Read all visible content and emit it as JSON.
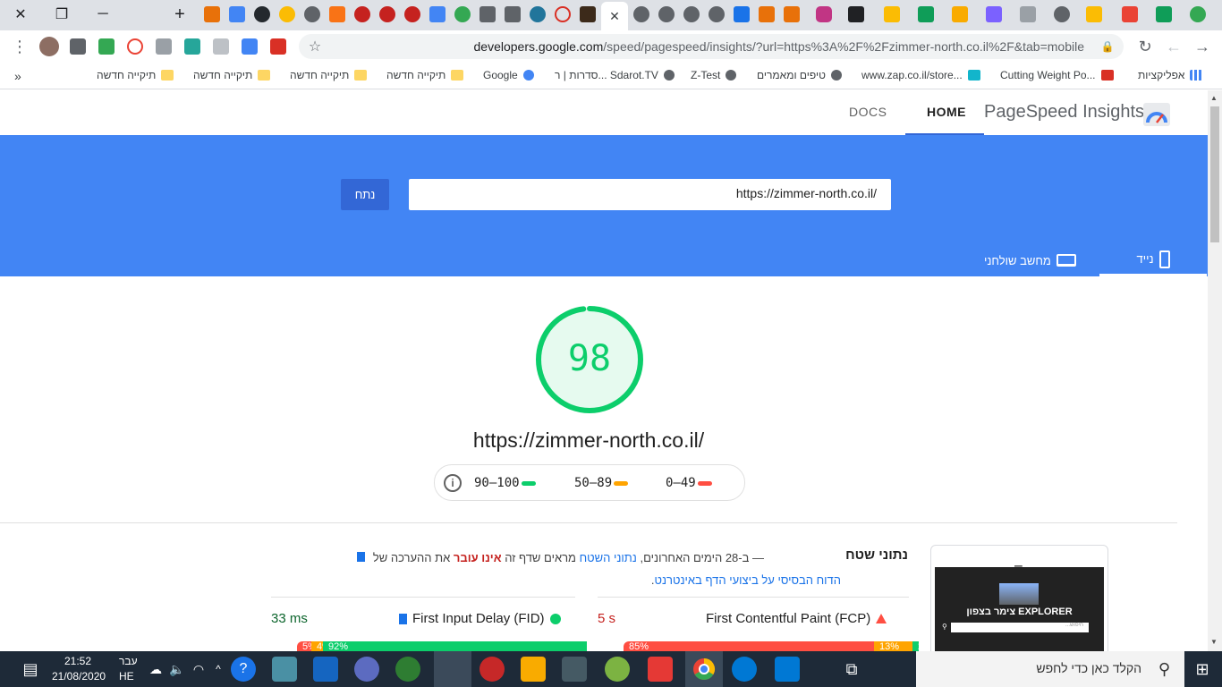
{
  "browser": {
    "address_bar": {
      "url_prefix": "developers.google.com",
      "url_rest": "/speed/pagespeed/insights/?url=https%3A%2F%2Fzimmer-north.co.il%2F&tab=mobile"
    },
    "bookmarks": [
      "אפליקציות",
      "Cutting Weight Po...",
      "www.zap.co.il/store...",
      "טיפים ומאמרים",
      "Z-Test",
      "סדרות | ר... Sdarot.TV",
      "Google",
      "תיקייה חדשה",
      "תיקייה חדשה",
      "תיקייה חדשה",
      "תיקייה חדשה"
    ],
    "bookmarks_overflow": "»"
  },
  "nav": {
    "brand": "PageSpeed Insights",
    "home": "HOME",
    "docs": "DOCS"
  },
  "hero": {
    "url_value": "https://zimmer-north.co.il/",
    "analyze_label": "נתח",
    "tab_mobile": "נייד",
    "tab_desktop": "מחשב שולחני"
  },
  "score": {
    "value": "98",
    "fraction": 0.98,
    "tested_url": "https://zimmer-north.co.il/",
    "color": "#0cce6b"
  },
  "legend": {
    "good": "90–100",
    "average": "50–89",
    "poor": "0–49",
    "colors": {
      "good": "#0cce6b",
      "average": "#ffa400",
      "poor": "#ff4e42"
    }
  },
  "field_data": {
    "title": "נתוני שטח",
    "desc_part1": "— ב-28 הימים האחרונים, ",
    "desc_link1": "נתוני השטח",
    "desc_part2": " מראים שדף זה ",
    "desc_highlight": "אינו עובר",
    "desc_part3": " את ההערכה של ",
    "desc_link2": "הדוח הבסיסי על ביצועי הדף באינטרנט",
    "desc_part4": ".",
    "metrics": [
      {
        "name": "First Contentful Paint (FCP)",
        "value": "5 s",
        "status": "poor",
        "distribution": [
          {
            "label": "85%",
            "fraction": 0.85,
            "color": "#ff4e42"
          },
          {
            "label": "13%",
            "fraction": 0.13,
            "color": "#ffa400"
          },
          {
            "label": "2%",
            "fraction": 0.02,
            "color": "#0cce6b"
          }
        ]
      },
      {
        "name": "First Input Delay (FID)",
        "value": "33 ms",
        "status": "good",
        "distribution": [
          {
            "label": "5%",
            "fraction": 0.05,
            "color": "#ff4e42"
          },
          {
            "label": "4%",
            "fraction": 0.04,
            "color": "#ffa400"
          },
          {
            "label": "92%",
            "fraction": 0.91,
            "color": "#0cce6b"
          }
        ]
      }
    ]
  },
  "thumbnail": {
    "site_title": "EXPLORER צימר בצפון",
    "search_placeholder": "חיפוש..."
  },
  "taskbar": {
    "search_placeholder": "הקלד כאן כדי לחפש",
    "time": "21:52",
    "date": "21/08/2020",
    "lang_top": "עבר",
    "lang_bottom": "HE"
  }
}
